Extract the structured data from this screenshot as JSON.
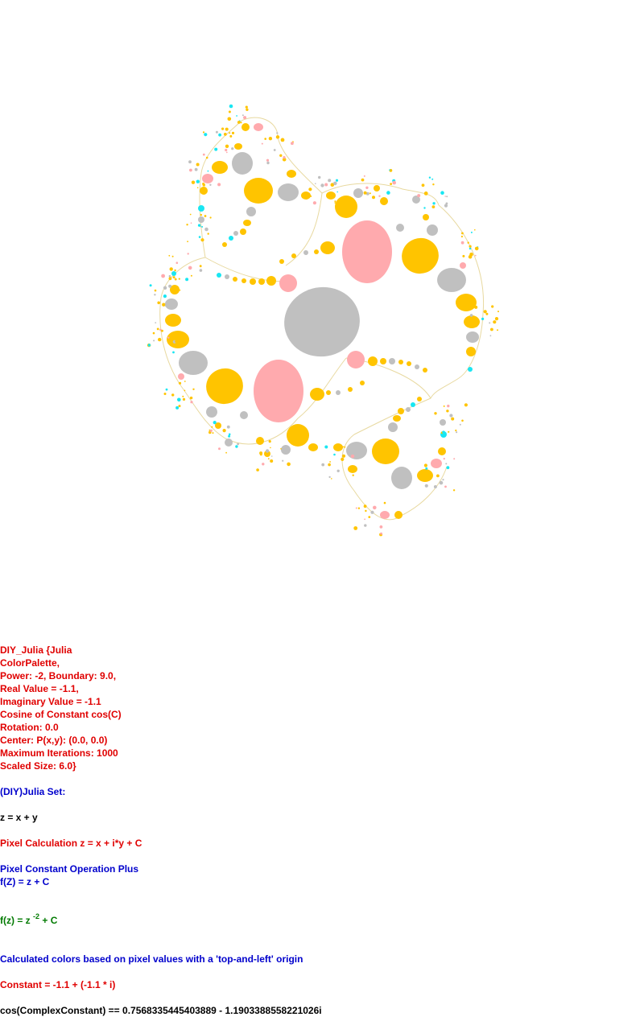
{
  "fractal": {
    "palette": {
      "gold": "#ffc400",
      "pink": "#ffaaae",
      "gray": "#c0c0c0",
      "cyan": "#19e6f2",
      "background": "#ffffff"
    }
  },
  "params": {
    "lines": [
      "DIY_Julia {Julia",
      "ColorPalette,",
      "Power: -2, Boundary: 9.0,",
      "Real Value = -1.1,",
      "Imaginary Value = -1.1",
      "Cosine of Constant cos(C)",
      "Rotation: 0.0",
      "Center: P(x,y): (0.0, 0.0)",
      "Maximum Iterations: 1000",
      "Scaled Size: 6.0}"
    ]
  },
  "set_title": "(DIY)Julia Set:",
  "z_def": "z = x + y",
  "pixel_calc": "Pixel Calculation z = x + i*y + C",
  "pixel_const_op": "Pixel Constant Operation Plus",
  "fz_plus": "f(Z) = z + C",
  "formula": {
    "prefix": "f(z) = z",
    "exponent": "-2",
    "suffix": " + C"
  },
  "colors_note": "Calculated colors based on pixel values with a 'top-and-left' origin",
  "constant": "Constant = -1.1 + (-1.1 * i)",
  "cos_constant": "cos(ComplexConstant) == 0.7568335445403889 - 1.1903388558221026i"
}
